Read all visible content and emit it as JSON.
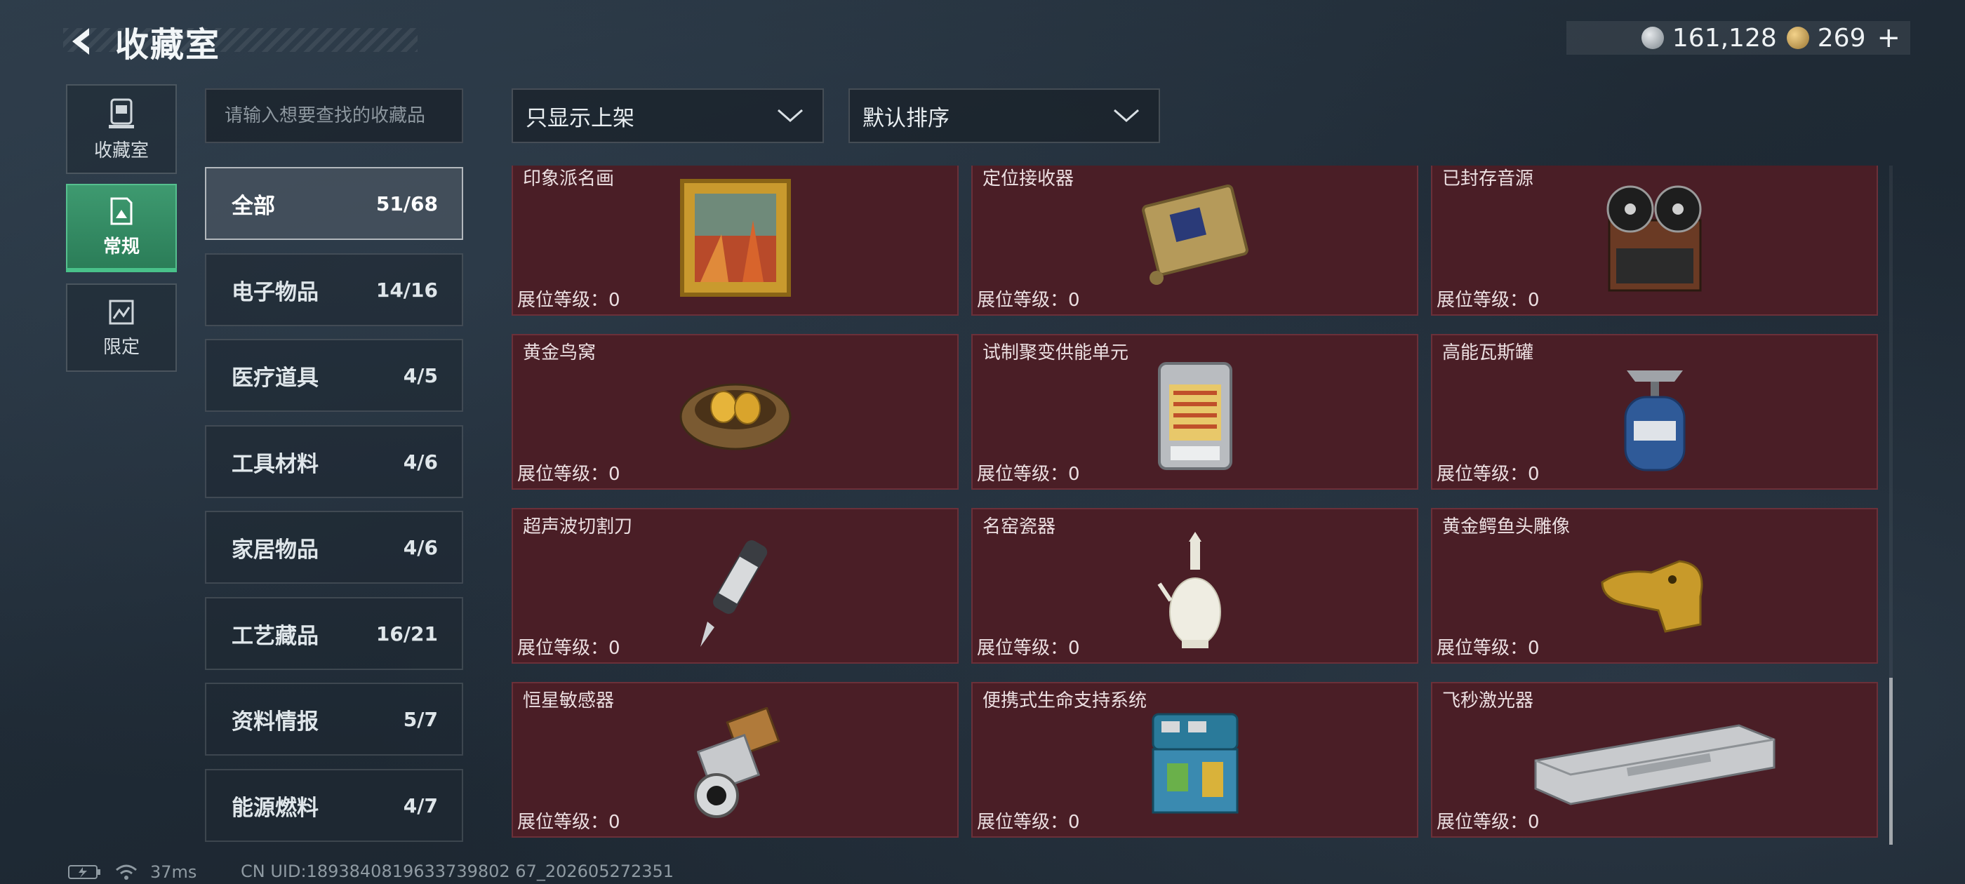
{
  "header": {
    "title": "收藏室"
  },
  "currency": {
    "silver_value": "161,128",
    "gold_value": "269",
    "plus": "+"
  },
  "side_tabs": [
    {
      "label": "收藏室"
    },
    {
      "label": "常规"
    },
    {
      "label": "限定"
    }
  ],
  "search": {
    "placeholder": "请输入想要查找的收藏品"
  },
  "filters": {
    "display_filter": "只显示上架",
    "sort": "默认排序"
  },
  "categories": [
    {
      "name": "全部",
      "count": "51/68"
    },
    {
      "name": "电子物品",
      "count": "14/16"
    },
    {
      "name": "医疗道具",
      "count": "4/5"
    },
    {
      "name": "工具材料",
      "count": "4/6"
    },
    {
      "name": "家居物品",
      "count": "4/6"
    },
    {
      "name": "工艺藏品",
      "count": "16/21"
    },
    {
      "name": "资料情报",
      "count": "5/7"
    },
    {
      "name": "能源燃料",
      "count": "4/7"
    }
  ],
  "items": [
    {
      "name": "印象派名画",
      "level": "展位等级：0",
      "icon": "painting-icon"
    },
    {
      "name": "定位接收器",
      "level": "展位等级：0",
      "icon": "receiver-icon"
    },
    {
      "name": "已封存音源",
      "level": "展位等级：0",
      "icon": "tape-recorder-icon"
    },
    {
      "name": "黄金鸟窝",
      "level": "展位等级：0",
      "icon": "golden-nest-icon"
    },
    {
      "name": "试制聚变供能单元",
      "level": "展位等级：0",
      "icon": "fusion-cell-icon"
    },
    {
      "name": "高能瓦斯罐",
      "level": "展位等级：0",
      "icon": "gas-tank-icon"
    },
    {
      "name": "超声波切割刀",
      "level": "展位等级：0",
      "icon": "ultrasonic-knife-icon"
    },
    {
      "name": "名窑瓷器",
      "level": "展位等级：0",
      "icon": "porcelain-vase-icon"
    },
    {
      "name": "黄金鳄鱼头雕像",
      "level": "展位等级：0",
      "icon": "gold-crocodile-icon"
    },
    {
      "name": "恒星敏感器",
      "level": "展位等级：0",
      "icon": "star-sensor-icon"
    },
    {
      "name": "便携式生命支持系统",
      "level": "展位等级：0",
      "icon": "life-support-icon"
    },
    {
      "name": "飞秒激光器",
      "level": "展位等级：0",
      "icon": "laser-device-icon"
    }
  ],
  "status": {
    "ping": "37ms",
    "uid": "CN UID:1893840819633739802 67_202605272351"
  }
}
